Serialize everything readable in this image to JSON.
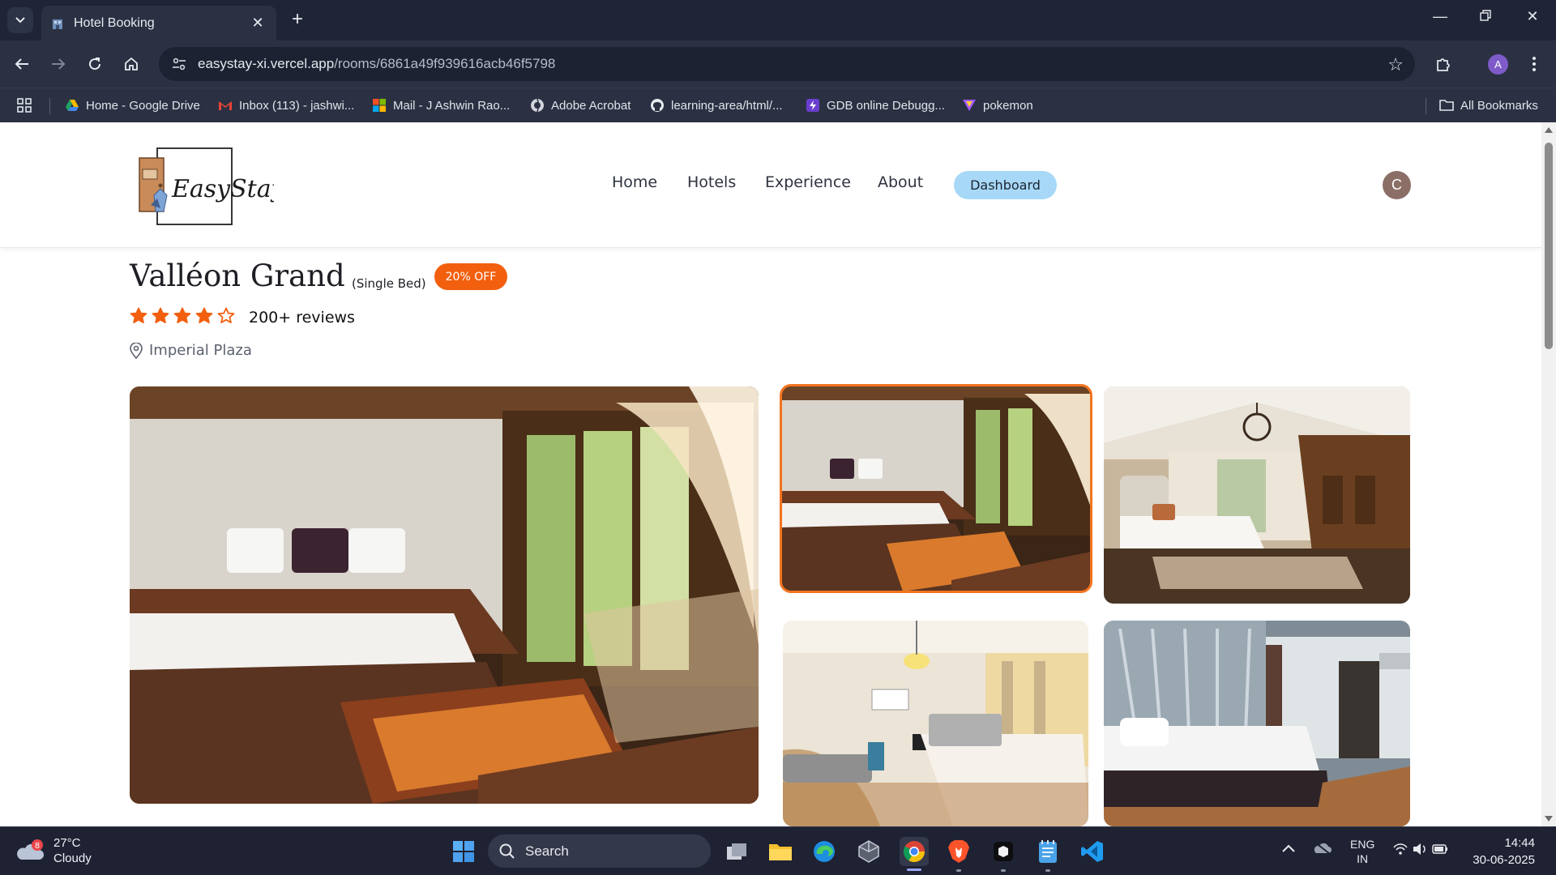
{
  "browser": {
    "tab_title": "Hotel Booking",
    "url_host": "easystay-xi.vercel.app",
    "url_path": "/rooms/6861a49f939616acb46f5798",
    "profile_initial": "A",
    "bookmarks": [
      {
        "label": "Home - Google Drive",
        "icon": "google-drive-icon"
      },
      {
        "label": "Inbox (113) - jashwi...",
        "icon": "gmail-icon"
      },
      {
        "label": "Mail - J Ashwin Rao...",
        "icon": "microsoft-icon"
      },
      {
        "label": "Adobe Acrobat",
        "icon": "acrobat-icon"
      },
      {
        "label": "learning-area/html/...",
        "icon": "github-icon"
      },
      {
        "label": "GDB online Debugg...",
        "icon": "gdb-icon"
      },
      {
        "label": "pokemon",
        "icon": "pokemon-icon"
      }
    ],
    "all_bookmarks": "All Bookmarks"
  },
  "site": {
    "logo_text": "EasyStay",
    "nav": [
      "Home",
      "Hotels",
      "Experience",
      "About"
    ],
    "dashboard_label": "Dashboard",
    "user_initial": "C"
  },
  "room": {
    "hotel_name": "Valléon Grand",
    "room_type": "(Single Bed)",
    "offer": "20% OFF",
    "rating": 4,
    "rating_max": 5,
    "reviews": "200+ reviews",
    "location": "Imperial Plaza",
    "selected_image": 1
  },
  "colors": {
    "star": "#f25f0e",
    "offer_bg": "#f25f0e",
    "dashboard_bg": "#a7d8f7",
    "selected_border": "#f2741f"
  },
  "taskbar": {
    "weather_temp": "27°C",
    "weather_desc": "Cloudy",
    "weather_badge": "8",
    "search_label": "Search",
    "lang_1": "ENG",
    "lang_2": "IN",
    "time": "14:44",
    "date": "30-06-2025"
  }
}
